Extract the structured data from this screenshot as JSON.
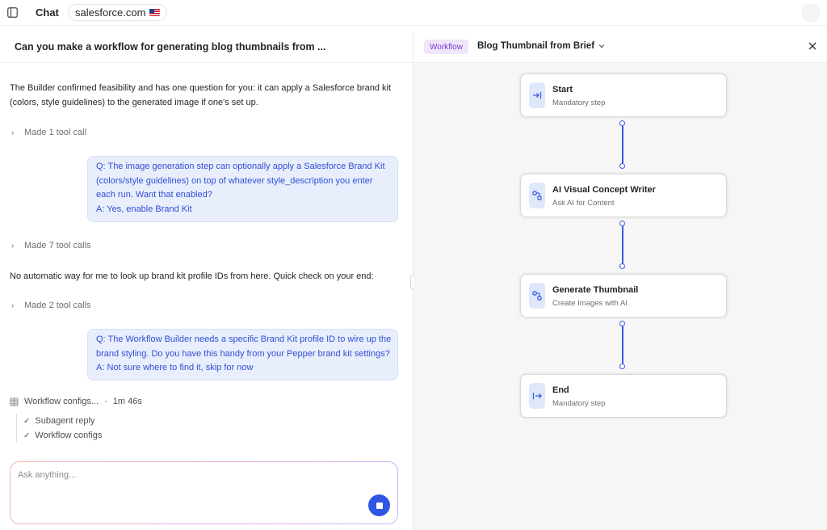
{
  "topbar": {
    "chat_label": "Chat",
    "site": "salesforce.com",
    "icons": [
      "sidebar-toggle-icon",
      "us-flag-icon",
      "avatar"
    ]
  },
  "chat": {
    "title": "Can you make a workflow for generating blog thumbnails from ...",
    "messages": {
      "intro_line1": "The Builder confirmed feasibility and has one question for you: it can apply a Salesforce brand kit",
      "intro_line2": "(colors, style guidelines) to the generated image if one's set up.",
      "tool_call_1": "Made 1 tool call",
      "bubble1_line1": "Q: The image generation step can optionally apply a Salesforce Brand Kit",
      "bubble1_line2": "(colors/style guidelines) on top of whatever style_description you enter",
      "bubble1_line3": "each run. Want that enabled?",
      "bubble1_line4": "A: Yes, enable Brand Kit",
      "tool_call_2": "Made 7 tool calls",
      "lookup_line": "No automatic way for me to look up brand kit profile IDs from here. Quick check on your end:",
      "tool_call_3": "Made 2 tool calls",
      "bubble2_line1": "Q: The Workflow Builder needs a specific Brand Kit profile ID to wire up the",
      "bubble2_line2": "brand styling. Do you have this handy from your Pepper brand kit settings?",
      "bubble2_line3": "A: Not sure where to find it, skip for now"
    },
    "status": {
      "label": "Workflow configs...",
      "separator": "·",
      "elapsed": "1m 46s",
      "substeps": [
        "Subagent reply",
        "Workflow configs"
      ]
    },
    "composer": {
      "placeholder": "Ask anything...",
      "value": ""
    }
  },
  "workflow": {
    "badge": "Workflow",
    "title": "Blog Thumbnail from Brief",
    "nodes": [
      {
        "title": "Start",
        "subtitle": "Mandatory step",
        "icon": "step-in-icon"
      },
      {
        "title": "AI Visual Concept Writer",
        "subtitle": "Ask AI for Content",
        "icon": "ai-connector-icon"
      },
      {
        "title": "Generate Thumbnail",
        "subtitle": "Create Images with AI",
        "icon": "ai-connector-icon"
      },
      {
        "title": "End",
        "subtitle": "Mandatory step",
        "icon": "step-out-icon"
      }
    ]
  },
  "colors": {
    "accent": "#2f55e4",
    "bubble_bg": "#e9eefc",
    "bubble_text": "#2f4fd6",
    "badge_bg": "#f0e6fb",
    "badge_text": "#7a3ccf",
    "canvas_bg": "#f6f6f6"
  }
}
